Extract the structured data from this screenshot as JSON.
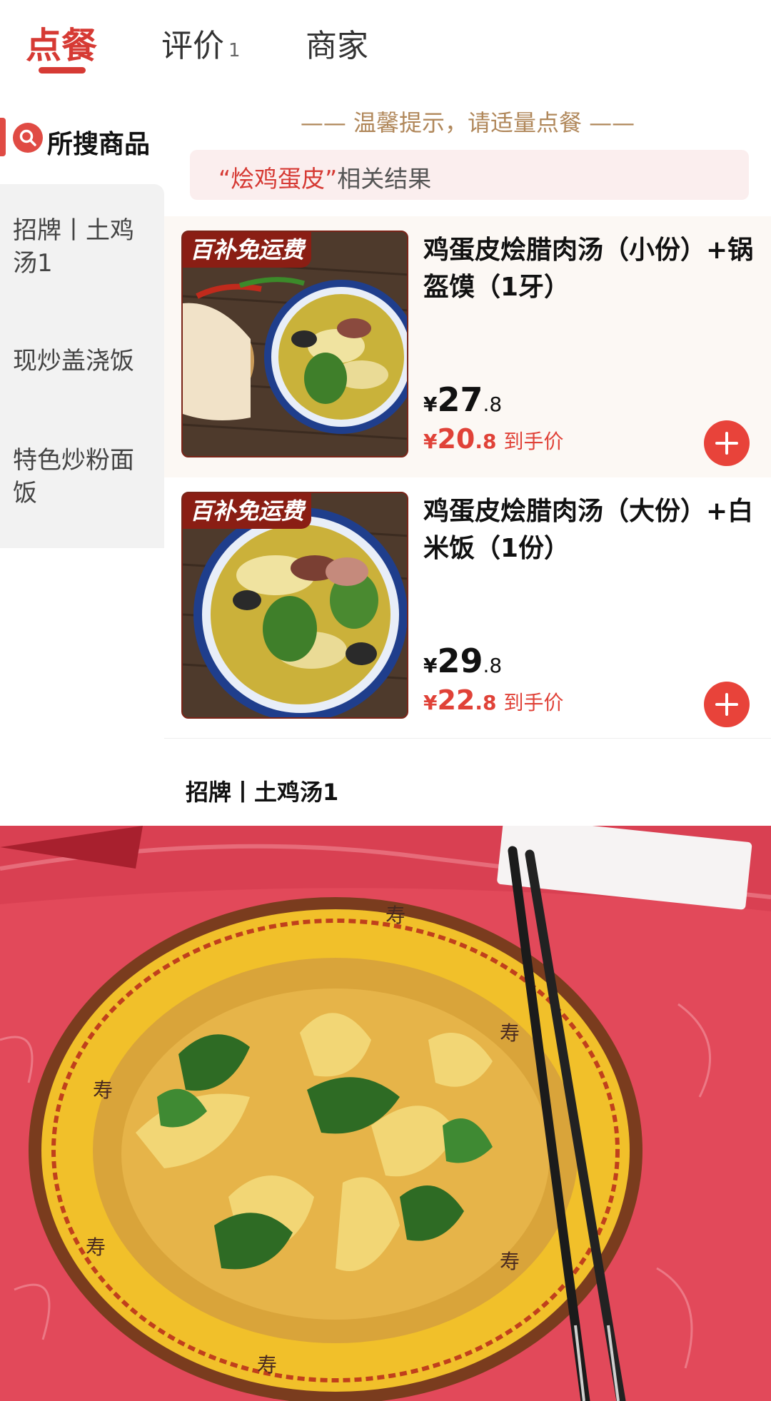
{
  "tabs": [
    {
      "label": "点餐",
      "active": true
    },
    {
      "label": "评价",
      "count": "1",
      "active": false
    },
    {
      "label": "商家",
      "active": false
    }
  ],
  "sidebar": {
    "search_label": "所搜商品",
    "search_icon": "search-icon",
    "categories": [
      {
        "label": "招牌丨土鸡汤1"
      },
      {
        "label": "现炒盖浇饭"
      },
      {
        "label": "特色炒粉面饭"
      }
    ]
  },
  "main": {
    "tip": "—— 温馨提示，请适量点餐 ——",
    "result_keyword": "“烩鸡蛋皮”",
    "result_suffix": "相关结果",
    "items": [
      {
        "badge": "百补免运费",
        "title": "鸡蛋皮烩腊肉汤（小份）+锅盔馍（1牙）",
        "price_currency": "¥",
        "price_int": "27",
        "price_dec": ".8",
        "final_currency": "¥",
        "final_int": "20",
        "final_dec": ".8",
        "final_label": "到手价",
        "add_icon": "plus-icon"
      },
      {
        "badge": "百补免运费",
        "title": "鸡蛋皮烩腊肉汤（大份）+白米饭（1份）",
        "price_currency": "¥",
        "price_int": "29",
        "price_dec": ".8",
        "final_currency": "¥",
        "final_int": "22",
        "final_dec": ".8",
        "final_label": "到手价",
        "add_icon": "plus-icon"
      }
    ],
    "section_title": "招牌丨土鸡汤1"
  },
  "colors": {
    "accent": "#d63a34",
    "tip": "#b0875a",
    "price_final": "#e04238"
  }
}
